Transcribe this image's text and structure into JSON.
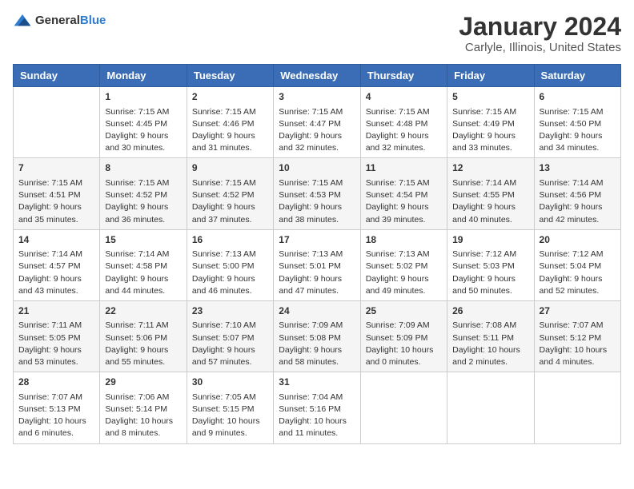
{
  "header": {
    "logo_general": "General",
    "logo_blue": "Blue",
    "month": "January 2024",
    "location": "Carlyle, Illinois, United States"
  },
  "weekdays": [
    "Sunday",
    "Monday",
    "Tuesday",
    "Wednesday",
    "Thursday",
    "Friday",
    "Saturday"
  ],
  "weeks": [
    [
      {
        "day": "",
        "info": ""
      },
      {
        "day": "1",
        "info": "Sunrise: 7:15 AM\nSunset: 4:45 PM\nDaylight: 9 hours\nand 30 minutes."
      },
      {
        "day": "2",
        "info": "Sunrise: 7:15 AM\nSunset: 4:46 PM\nDaylight: 9 hours\nand 31 minutes."
      },
      {
        "day": "3",
        "info": "Sunrise: 7:15 AM\nSunset: 4:47 PM\nDaylight: 9 hours\nand 32 minutes."
      },
      {
        "day": "4",
        "info": "Sunrise: 7:15 AM\nSunset: 4:48 PM\nDaylight: 9 hours\nand 32 minutes."
      },
      {
        "day": "5",
        "info": "Sunrise: 7:15 AM\nSunset: 4:49 PM\nDaylight: 9 hours\nand 33 minutes."
      },
      {
        "day": "6",
        "info": "Sunrise: 7:15 AM\nSunset: 4:50 PM\nDaylight: 9 hours\nand 34 minutes."
      }
    ],
    [
      {
        "day": "7",
        "info": "Sunrise: 7:15 AM\nSunset: 4:51 PM\nDaylight: 9 hours\nand 35 minutes."
      },
      {
        "day": "8",
        "info": "Sunrise: 7:15 AM\nSunset: 4:52 PM\nDaylight: 9 hours\nand 36 minutes."
      },
      {
        "day": "9",
        "info": "Sunrise: 7:15 AM\nSunset: 4:52 PM\nDaylight: 9 hours\nand 37 minutes."
      },
      {
        "day": "10",
        "info": "Sunrise: 7:15 AM\nSunset: 4:53 PM\nDaylight: 9 hours\nand 38 minutes."
      },
      {
        "day": "11",
        "info": "Sunrise: 7:15 AM\nSunset: 4:54 PM\nDaylight: 9 hours\nand 39 minutes."
      },
      {
        "day": "12",
        "info": "Sunrise: 7:14 AM\nSunset: 4:55 PM\nDaylight: 9 hours\nand 40 minutes."
      },
      {
        "day": "13",
        "info": "Sunrise: 7:14 AM\nSunset: 4:56 PM\nDaylight: 9 hours\nand 42 minutes."
      }
    ],
    [
      {
        "day": "14",
        "info": "Sunrise: 7:14 AM\nSunset: 4:57 PM\nDaylight: 9 hours\nand 43 minutes."
      },
      {
        "day": "15",
        "info": "Sunrise: 7:14 AM\nSunset: 4:58 PM\nDaylight: 9 hours\nand 44 minutes."
      },
      {
        "day": "16",
        "info": "Sunrise: 7:13 AM\nSunset: 5:00 PM\nDaylight: 9 hours\nand 46 minutes."
      },
      {
        "day": "17",
        "info": "Sunrise: 7:13 AM\nSunset: 5:01 PM\nDaylight: 9 hours\nand 47 minutes."
      },
      {
        "day": "18",
        "info": "Sunrise: 7:13 AM\nSunset: 5:02 PM\nDaylight: 9 hours\nand 49 minutes."
      },
      {
        "day": "19",
        "info": "Sunrise: 7:12 AM\nSunset: 5:03 PM\nDaylight: 9 hours\nand 50 minutes."
      },
      {
        "day": "20",
        "info": "Sunrise: 7:12 AM\nSunset: 5:04 PM\nDaylight: 9 hours\nand 52 minutes."
      }
    ],
    [
      {
        "day": "21",
        "info": "Sunrise: 7:11 AM\nSunset: 5:05 PM\nDaylight: 9 hours\nand 53 minutes."
      },
      {
        "day": "22",
        "info": "Sunrise: 7:11 AM\nSunset: 5:06 PM\nDaylight: 9 hours\nand 55 minutes."
      },
      {
        "day": "23",
        "info": "Sunrise: 7:10 AM\nSunset: 5:07 PM\nDaylight: 9 hours\nand 57 minutes."
      },
      {
        "day": "24",
        "info": "Sunrise: 7:09 AM\nSunset: 5:08 PM\nDaylight: 9 hours\nand 58 minutes."
      },
      {
        "day": "25",
        "info": "Sunrise: 7:09 AM\nSunset: 5:09 PM\nDaylight: 10 hours\nand 0 minutes."
      },
      {
        "day": "26",
        "info": "Sunrise: 7:08 AM\nSunset: 5:11 PM\nDaylight: 10 hours\nand 2 minutes."
      },
      {
        "day": "27",
        "info": "Sunrise: 7:07 AM\nSunset: 5:12 PM\nDaylight: 10 hours\nand 4 minutes."
      }
    ],
    [
      {
        "day": "28",
        "info": "Sunrise: 7:07 AM\nSunset: 5:13 PM\nDaylight: 10 hours\nand 6 minutes."
      },
      {
        "day": "29",
        "info": "Sunrise: 7:06 AM\nSunset: 5:14 PM\nDaylight: 10 hours\nand 8 minutes."
      },
      {
        "day": "30",
        "info": "Sunrise: 7:05 AM\nSunset: 5:15 PM\nDaylight: 10 hours\nand 9 minutes."
      },
      {
        "day": "31",
        "info": "Sunrise: 7:04 AM\nSunset: 5:16 PM\nDaylight: 10 hours\nand 11 minutes."
      },
      {
        "day": "",
        "info": ""
      },
      {
        "day": "",
        "info": ""
      },
      {
        "day": "",
        "info": ""
      }
    ]
  ]
}
